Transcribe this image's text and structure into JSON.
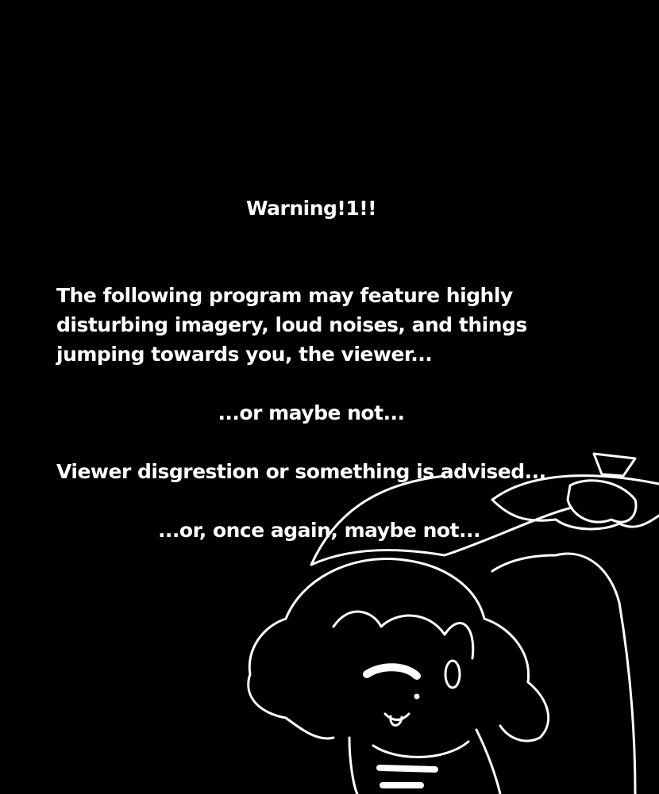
{
  "colors": {
    "background": "#000000",
    "text": "#ffffff"
  },
  "warning": {
    "title": "Warning!1!!",
    "body_lines": [
      "The following program may feature highly",
      "disturbing imagery, loud noises, and things",
      "jumping towards you, the viewer..."
    ],
    "line2": "...or maybe not...",
    "line3": "Viewer disgrestion or something is advised...",
    "line4": "...or, once again, maybe not..."
  }
}
